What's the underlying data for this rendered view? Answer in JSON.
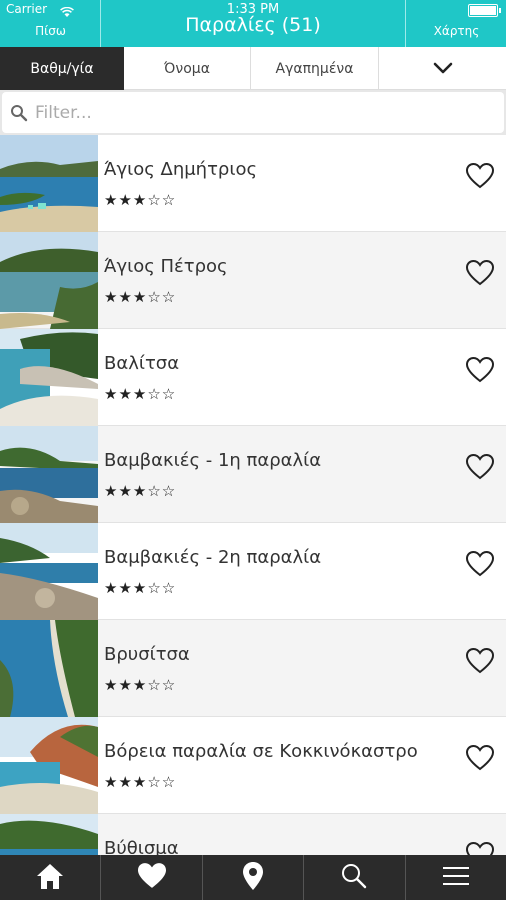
{
  "status_bar": {
    "carrier": "Carrier",
    "time": "1:33 PM"
  },
  "nav": {
    "back_label": "Πίσω",
    "title": "Παραλίες (51)",
    "map_label": "Χάρτης"
  },
  "sort_tabs": [
    {
      "label": "Βαθμ/γία",
      "active": true
    },
    {
      "label": "Όνομα",
      "active": false
    },
    {
      "label": "Αγαπημένα",
      "active": false
    }
  ],
  "filter": {
    "placeholder": "Filter...",
    "value": ""
  },
  "beaches": [
    {
      "name": "Άγιος Δημήτριος",
      "rating": "★★★☆☆"
    },
    {
      "name": "Άγιος Πέτρος",
      "rating": "★★★☆☆"
    },
    {
      "name": "Βαλίτσα",
      "rating": "★★★☆☆"
    },
    {
      "name": "Βαμβακιές - 1η παραλία",
      "rating": "★★★☆☆"
    },
    {
      "name": "Βαμβακιές - 2η παραλία",
      "rating": "★★★☆☆"
    },
    {
      "name": "Βρυσίτσα",
      "rating": "★★★☆☆"
    },
    {
      "name": "Βόρεια παραλία σε Κοκκινόκαστρο",
      "rating": "★★★☆☆"
    },
    {
      "name": "Βύθισμα",
      "rating": "★★★☆☆"
    }
  ],
  "tab_bar": [
    "home-icon",
    "heart-icon",
    "location-pin-icon",
    "search-icon",
    "menu-icon"
  ],
  "colors": {
    "accent": "#1fc7c7",
    "dark": "#2b2b2b"
  }
}
